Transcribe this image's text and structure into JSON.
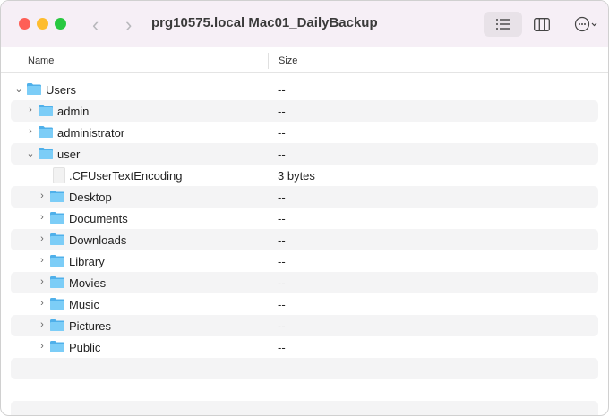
{
  "window": {
    "title": "prg10575.local Mac01_DailyBackup"
  },
  "toolbar": {
    "back": "‹",
    "forward": "›",
    "list_view": "list-view-icon",
    "column_view": "column-view-icon",
    "more": "more-icon"
  },
  "columns": {
    "name": "Name",
    "size": "Size"
  },
  "rows": [
    {
      "name": "Users",
      "size": "--",
      "level": 0,
      "type": "folder",
      "expanded": true
    },
    {
      "name": "admin",
      "size": "--",
      "level": 1,
      "type": "folder",
      "expanded": false
    },
    {
      "name": "administrator",
      "size": "--",
      "level": 1,
      "type": "folder",
      "expanded": false
    },
    {
      "name": "user",
      "size": "--",
      "level": 1,
      "type": "folder",
      "expanded": true
    },
    {
      "name": ".CFUserTextEncoding",
      "size": "3 bytes",
      "level": 2,
      "type": "file"
    },
    {
      "name": "Desktop",
      "size": "--",
      "level": 2,
      "type": "folder",
      "expanded": false
    },
    {
      "name": "Documents",
      "size": "--",
      "level": 2,
      "type": "folder",
      "expanded": false
    },
    {
      "name": "Downloads",
      "size": "--",
      "level": 2,
      "type": "folder",
      "expanded": false
    },
    {
      "name": "Library",
      "size": "--",
      "level": 2,
      "type": "folder",
      "expanded": false
    },
    {
      "name": "Movies",
      "size": "--",
      "level": 2,
      "type": "folder",
      "expanded": false
    },
    {
      "name": "Music",
      "size": "--",
      "level": 2,
      "type": "folder",
      "expanded": false
    },
    {
      "name": "Pictures",
      "size": "--",
      "level": 2,
      "type": "folder",
      "expanded": false
    },
    {
      "name": "Public",
      "size": "--",
      "level": 2,
      "type": "folder",
      "expanded": false
    }
  ]
}
